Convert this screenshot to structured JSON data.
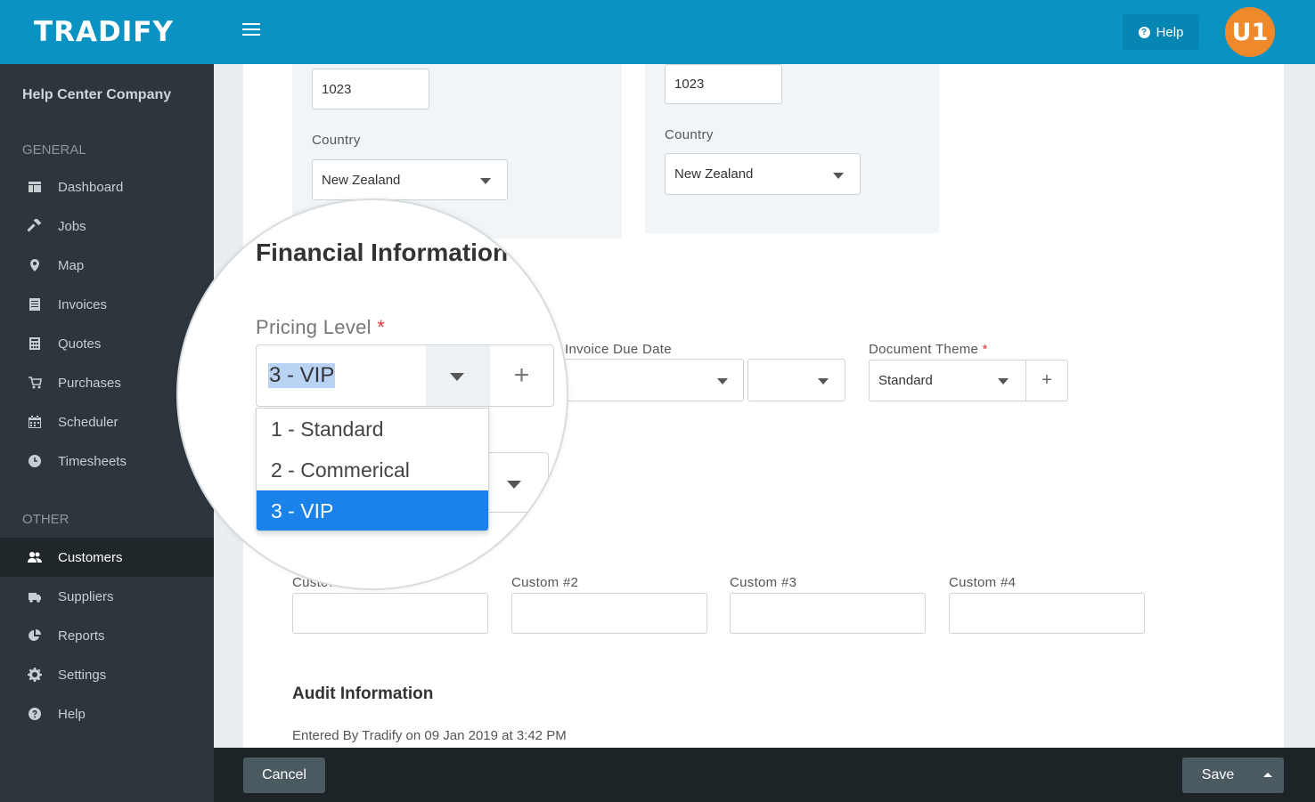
{
  "header": {
    "logo": "TRADIFY",
    "help_label": "Help",
    "avatar_initials": "U1"
  },
  "sidebar": {
    "company": "Help Center Company",
    "general_label": "GENERAL",
    "other_label": "OTHER",
    "general_items": [
      {
        "label": "Dashboard",
        "icon": "dashboard-icon"
      },
      {
        "label": "Jobs",
        "icon": "hammer-icon"
      },
      {
        "label": "Map",
        "icon": "map-pin-icon"
      },
      {
        "label": "Invoices",
        "icon": "invoice-icon"
      },
      {
        "label": "Quotes",
        "icon": "calculator-icon"
      },
      {
        "label": "Purchases",
        "icon": "cart-icon"
      },
      {
        "label": "Scheduler",
        "icon": "calendar-icon"
      },
      {
        "label": "Timesheets",
        "icon": "clock-icon"
      }
    ],
    "other_items": [
      {
        "label": "Customers",
        "icon": "users-icon",
        "active": true
      },
      {
        "label": "Suppliers",
        "icon": "truck-icon"
      },
      {
        "label": "Reports",
        "icon": "pie-chart-icon"
      },
      {
        "label": "Settings",
        "icon": "gear-icon"
      },
      {
        "label": "Help",
        "icon": "question-icon"
      }
    ]
  },
  "address_left": {
    "postcode": "1023",
    "country_label": "Country",
    "country_value": "New Zealand"
  },
  "address_right": {
    "postcode": "1023",
    "country_label": "Country",
    "country_value": "New Zealand"
  },
  "financial": {
    "heading": "Financial Information",
    "pricing_level_label": "Pricing Level",
    "required_mark": "*",
    "pricing_level_value": "3 - VIP",
    "pricing_options": [
      "1 - Standard",
      "2 - Commerical",
      "3 - VIP"
    ],
    "selected_option": "3 - VIP",
    "invoice_due_label": "Invoice Due Date",
    "document_theme_label": "Document Theme",
    "document_theme_value": "Standard"
  },
  "custom": {
    "custom1_label": "Custo…",
    "custom2_label": "Custom #2",
    "custom3_label": "Custom #3",
    "custom4_label": "Custom #4"
  },
  "audit": {
    "heading": "Audit Information",
    "entered_by": "Entered By Tradify on 09 Jan 2019 at 3:42 PM"
  },
  "footer": {
    "cancel_label": "Cancel",
    "save_label": "Save"
  },
  "colors": {
    "header": "#0a93c2",
    "sidebar": "#2c363c",
    "accent_selected": "#1a82e8",
    "avatar": "#f0892b"
  }
}
